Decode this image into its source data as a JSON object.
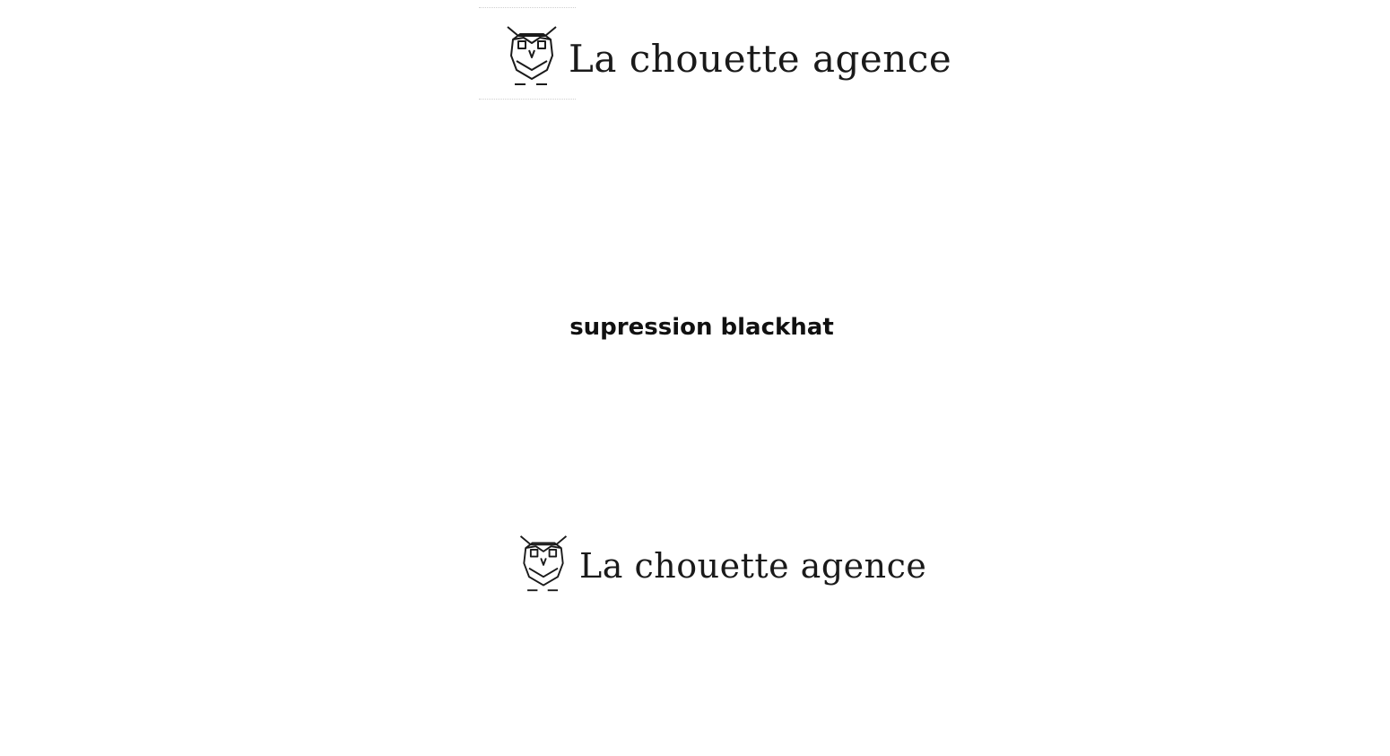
{
  "header_logo": {
    "text": "La chouette agence",
    "icon": "owl-icon"
  },
  "heading": "supression blackhat",
  "footer_logo": {
    "text": "La chouette agence",
    "icon": "owl-icon"
  },
  "colors": {
    "background": "#ffffff",
    "text": "#111111",
    "logo": "#1a1a1a"
  }
}
